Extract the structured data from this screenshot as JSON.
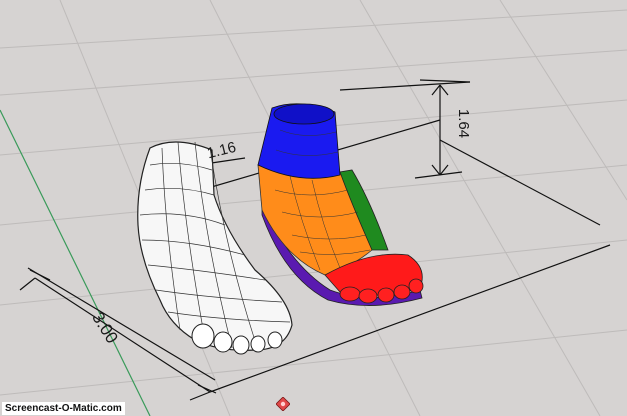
{
  "viewport": {
    "dimensions": {
      "width_label": "1.16",
      "height_label": "1.64",
      "length_label": "3.00"
    }
  },
  "watermark": {
    "text": "Screencast-O-Matic.com"
  },
  "colors": {
    "background": "#d6d3d2",
    "grid": "#bcb9b8",
    "axis_green": "#2e8b57",
    "region_ankle": "#1a1af0",
    "region_mid": "#ff8c1a",
    "region_side": "#1f8a1f",
    "region_toes": "#ff1a1a",
    "region_sole": "#5a1ab0"
  },
  "icons": {
    "gizmo": "center-gizmo-icon"
  }
}
